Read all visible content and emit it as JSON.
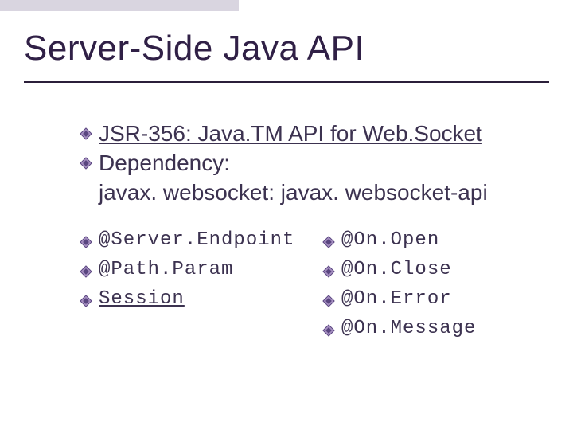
{
  "title": "Server-Side Java API",
  "bullets": {
    "b0": "JSR-356: Java.TM API for Web.Socket",
    "b1": "Dependency:",
    "b1_sub": "javax. websocket: javax. websocket-api"
  },
  "left": {
    "i0": "@Server.Endpoint",
    "i1": "@Path.Param",
    "i2": "Session"
  },
  "right": {
    "i0": "@On.Open",
    "i1": "@On.Close",
    "i2": "@On.Error",
    "i3": "@On.Message"
  },
  "icon_name": "diamond-bullet"
}
